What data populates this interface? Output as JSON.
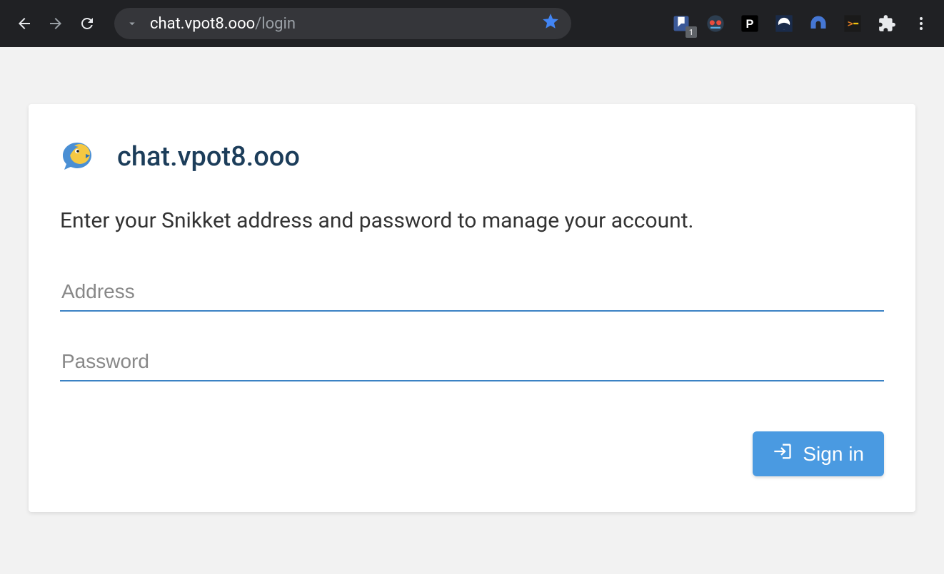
{
  "browser": {
    "url_domain": "chat.vpot8.ooo",
    "url_path": "/login",
    "extension_badge": "1"
  },
  "page": {
    "site_title": "chat.vpot8.ooo",
    "instruction": "Enter your Snikket address and password to manage your account.",
    "address_placeholder": "Address",
    "password_placeholder": "Password",
    "signin_label": "Sign in"
  }
}
